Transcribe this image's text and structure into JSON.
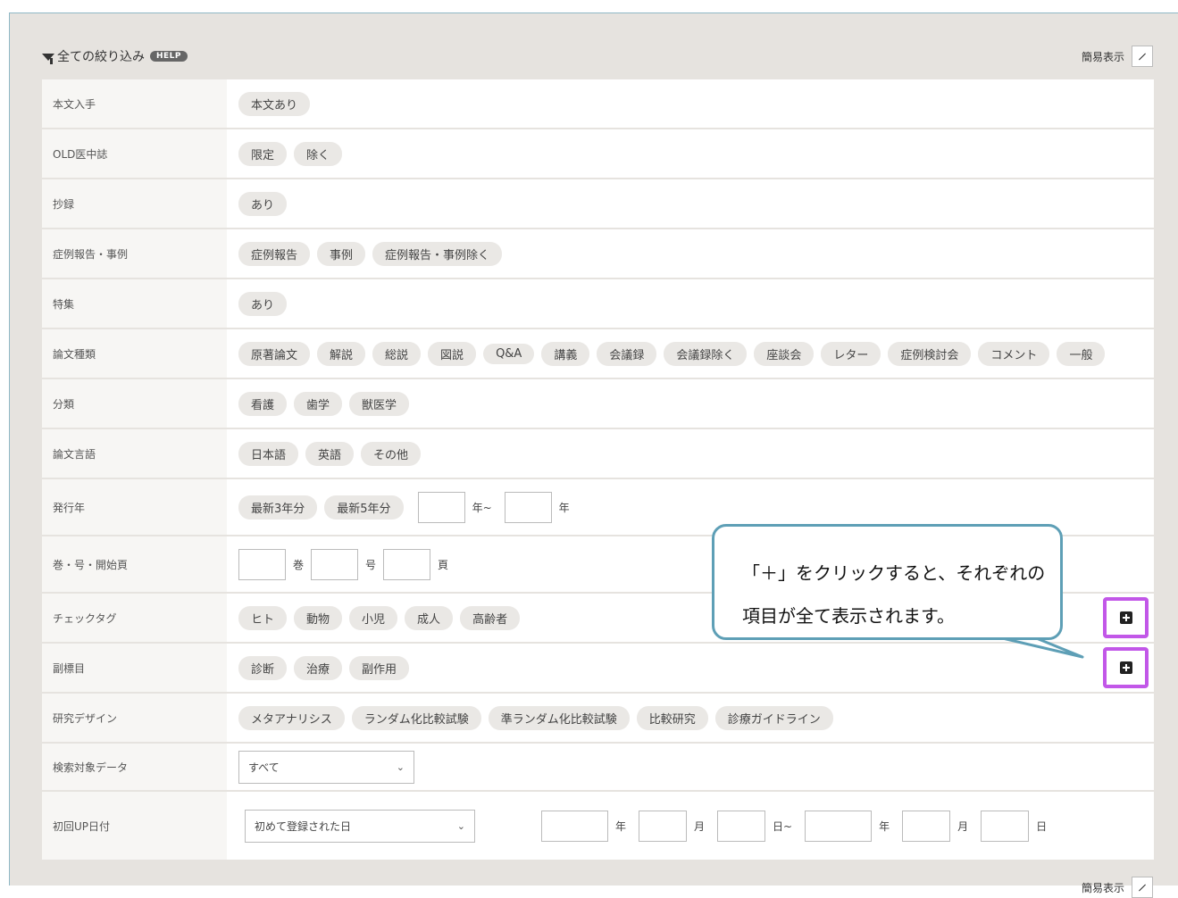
{
  "header": {
    "title": "全ての絞り込み",
    "help_label": "HELP",
    "simple_view_label": "簡易表示"
  },
  "rows": {
    "fulltext": {
      "label": "本文入手",
      "chips": [
        "本文あり"
      ]
    },
    "old": {
      "label": "OLD医中誌",
      "chips": [
        "限定",
        "除く"
      ]
    },
    "abstract": {
      "label": "抄録",
      "chips": [
        "あり"
      ]
    },
    "case": {
      "label": "症例報告・事例",
      "chips": [
        "症例報告",
        "事例",
        "症例報告・事例除く"
      ]
    },
    "special": {
      "label": "特集",
      "chips": [
        "あり"
      ]
    },
    "type": {
      "label": "論文種類",
      "chips": [
        "原著論文",
        "解説",
        "総説",
        "図説",
        "Q&A",
        "講義",
        "会議録",
        "会議録除く",
        "座談会",
        "レター",
        "症例検討会",
        "コメント",
        "一般"
      ]
    },
    "category": {
      "label": "分類",
      "chips": [
        "看護",
        "歯学",
        "獣医学"
      ]
    },
    "language": {
      "label": "論文言語",
      "chips": [
        "日本語",
        "英語",
        "その他"
      ]
    },
    "year": {
      "label": "発行年",
      "chips": [
        "最新3年分",
        "最新5年分"
      ],
      "unit_from": "年~",
      "unit_to": "年"
    },
    "volume": {
      "label": "巻・号・開始頁",
      "unit_vol": "巻",
      "unit_no": "号",
      "unit_page": "頁"
    },
    "checktag": {
      "label": "チェックタグ",
      "chips": [
        "ヒト",
        "動物",
        "小児",
        "成人",
        "高齢者"
      ]
    },
    "subheading": {
      "label": "副標目",
      "chips": [
        "診断",
        "治療",
        "副作用"
      ]
    },
    "design": {
      "label": "研究デザイン",
      "chips": [
        "メタアナリシス",
        "ランダム化比較試験",
        "準ランダム化比較試験",
        "比較研究",
        "診療ガイドライン"
      ]
    },
    "target": {
      "label": "検索対象データ",
      "select_value": "すべて"
    },
    "firstup": {
      "label": "初回UP日付",
      "select_value": "初めて登録された日",
      "u_year": "年",
      "u_month": "月",
      "u_day_from": "日~",
      "u_year2": "年",
      "u_month2": "月",
      "u_day2": "日"
    }
  },
  "callout": {
    "line1": "「＋」をクリックすると、それぞれの",
    "line2": "項目が全て表示されます。"
  },
  "colors": {
    "highlight": "#c257e8",
    "callout_border": "#5e9fb6"
  }
}
